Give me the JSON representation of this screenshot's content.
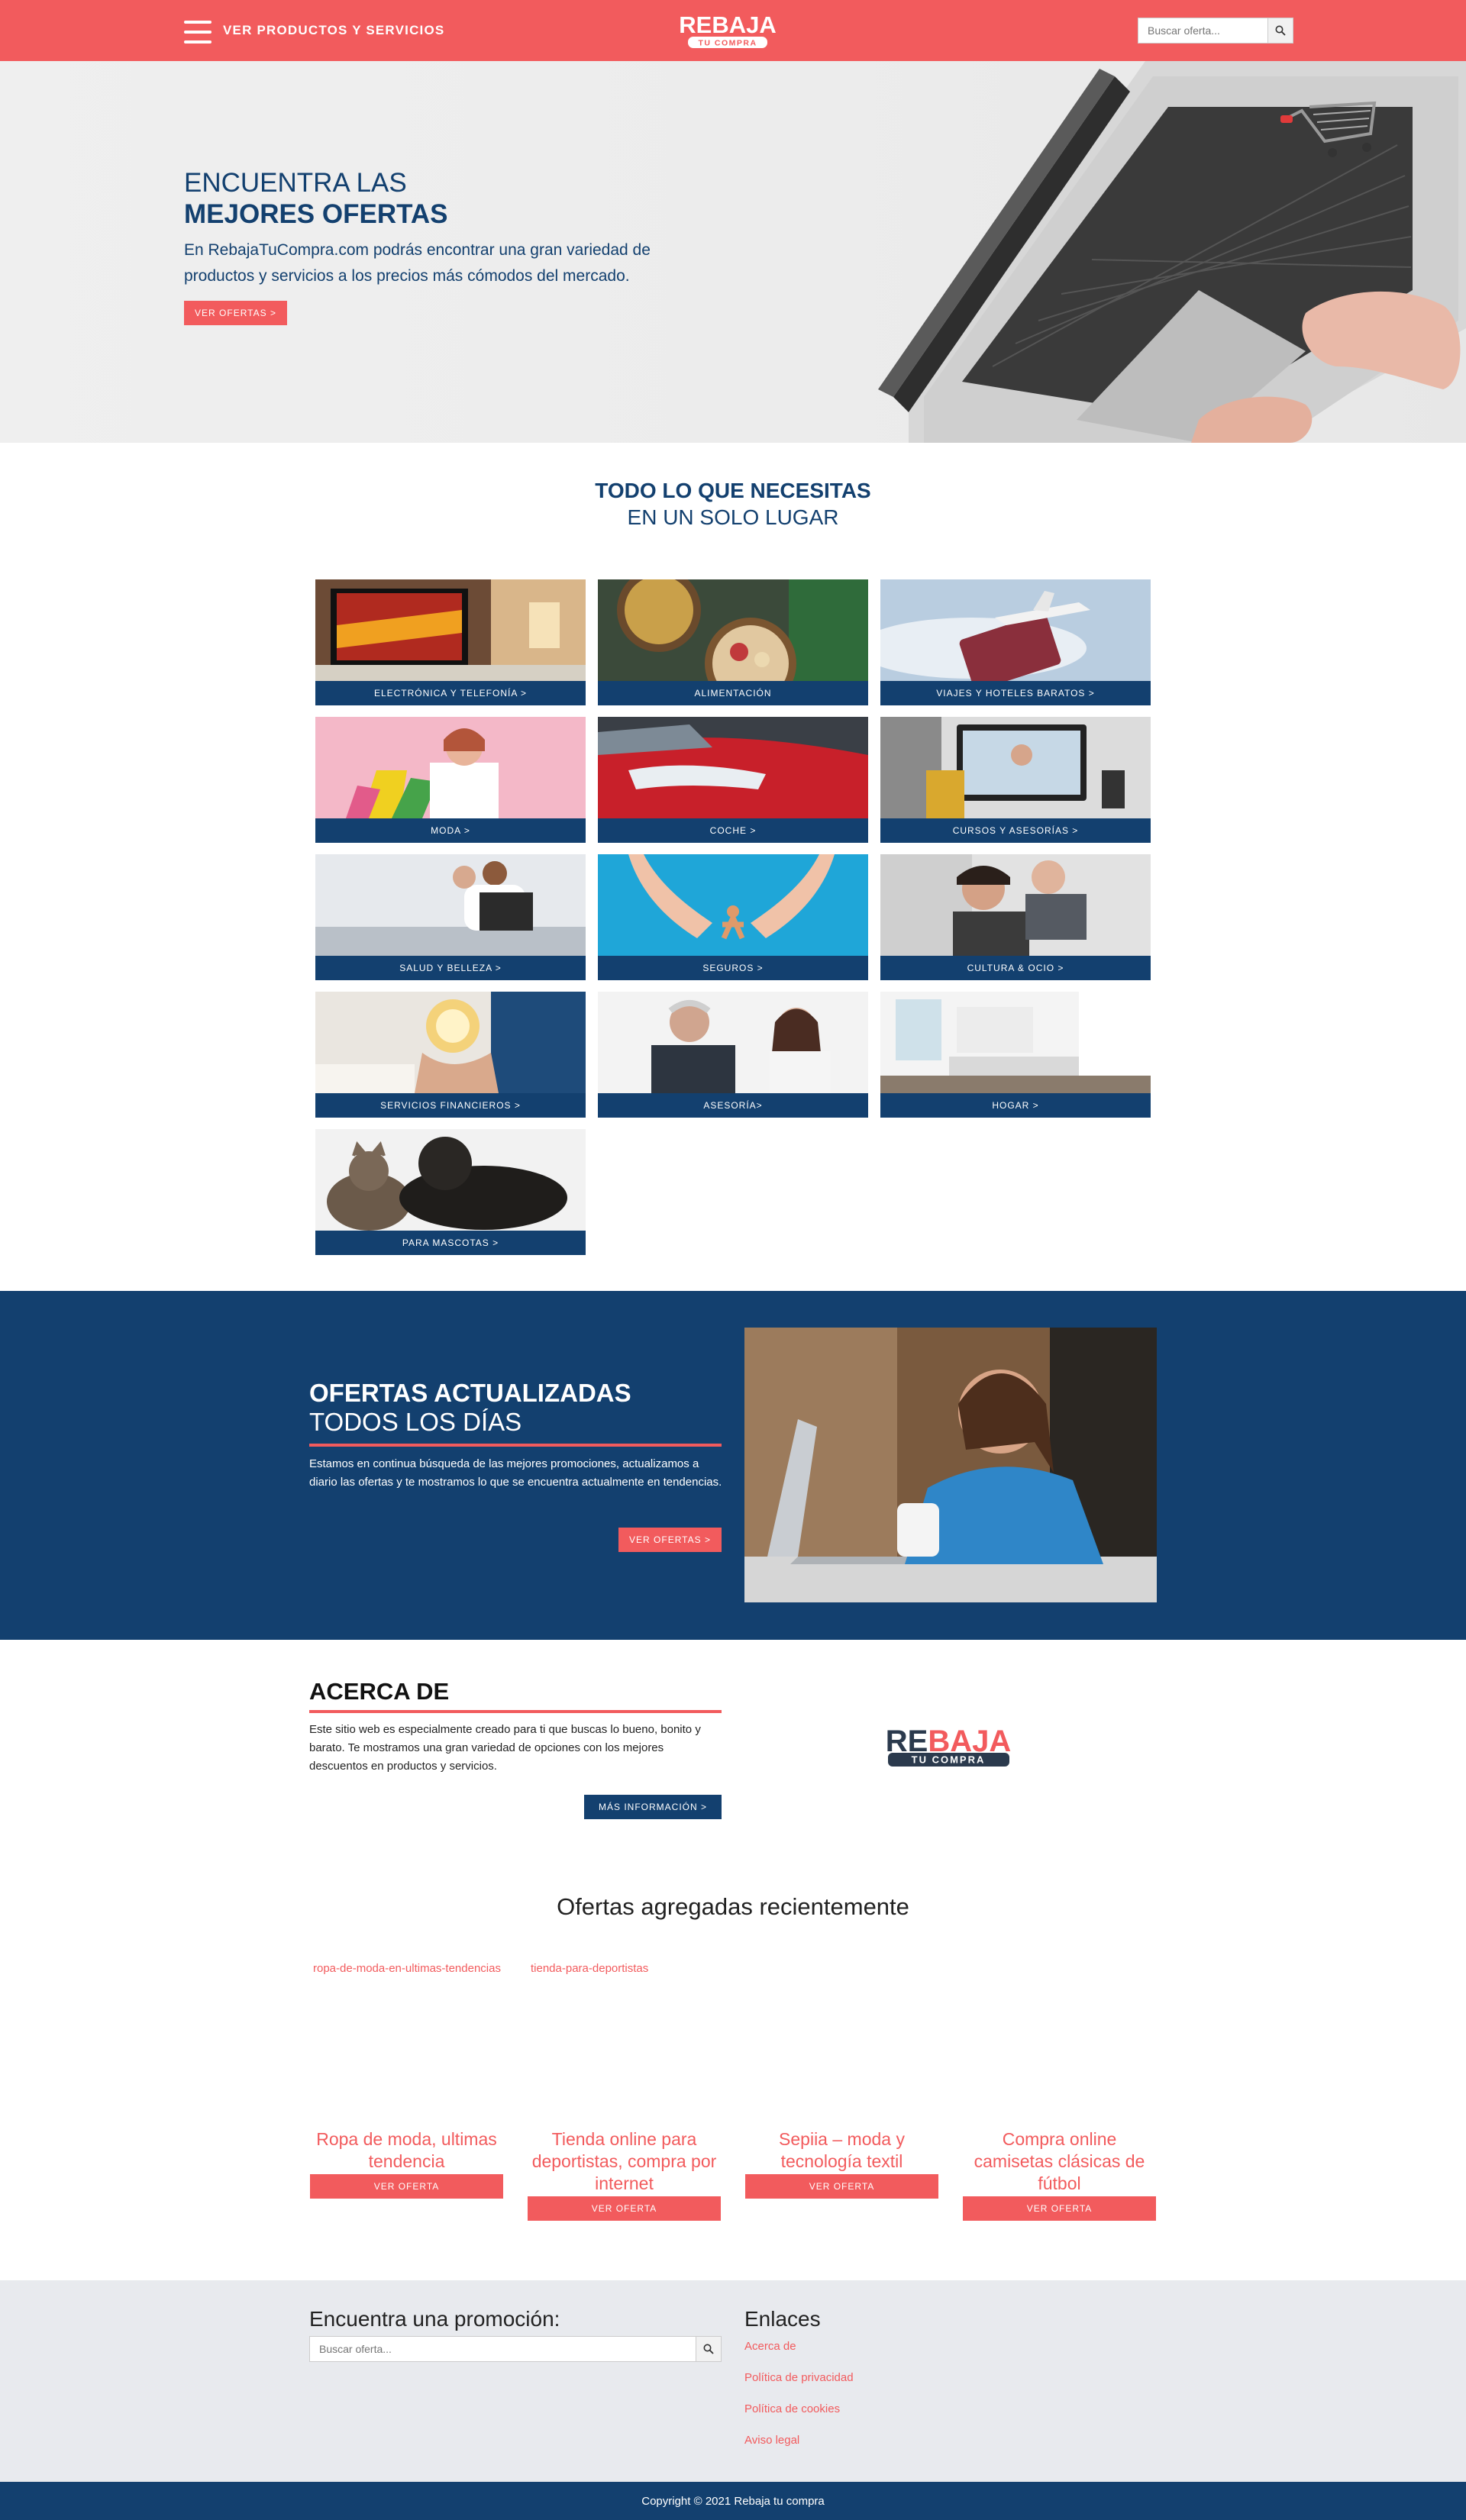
{
  "header": {
    "menu_label": "VER PRODUCTOS Y SERVICIOS",
    "logo_main": "REBAJA",
    "logo_sub": "TU COMPRA",
    "search_placeholder": "Buscar oferta..."
  },
  "hero": {
    "title_line1": "ENCUENTRA LAS",
    "title_line2": "MEJORES OFERTAS",
    "description": "En RebajaTuCompra.com podrás encontrar una gran variedad de productos y servicios a los precios más cómodos del mercado.",
    "button": "VER OFERTAS >"
  },
  "categories_section": {
    "title_line1": "TODO LO QUE NECESITAS",
    "title_line2": "EN UN SOLO LUGAR",
    "items": [
      "ELECTRÓNICA Y TELEFONÍA >",
      "ALIMENTACIÓN",
      "VIAJES Y HOTELES BARATOS >",
      "MODA >",
      "COCHE >",
      "CURSOS Y ASESORÍAS >",
      "SALUD Y BELLEZA >",
      "SEGUROS >",
      "CULTURA & OCIO >",
      "SERVICIOS FINANCIEROS >",
      "ASESORÍA>",
      "HOGAR >",
      "PARA MASCOTAS >"
    ]
  },
  "updated_offers": {
    "title_line1": "OFERTAS ACTUALIZADAS",
    "title_line2": "TODOS LOS DÍAS",
    "description": "Estamos en continua búsqueda de las mejores promociones, actualizamos a diario las ofertas y te mostramos lo que se encuentra actualmente en tendencias.",
    "button": "VER OFERTAS >"
  },
  "about": {
    "title": "ACERCA DE",
    "description": "Este sitio web es especialmente creado para ti que buscas lo bueno, bonito y barato. Te mostramos una gran variedad de opciones con los mejores descuentos en productos y servicios.",
    "button": "MÁS INFORMACIÓN >"
  },
  "recent": {
    "title": "Ofertas agregadas recientemente",
    "broken_images": [
      "ropa-de-moda-en-ultimas-tendencias",
      "tienda-para-deportistas"
    ],
    "offers": [
      "Ropa de moda, ultimas tendencia",
      "Tienda online para deportistas, compra por internet",
      "Sepiia – moda y tecnología textil",
      "Compra online camisetas clásicas de fútbol"
    ],
    "button": "VER OFERTA"
  },
  "footer": {
    "search_title": "Encuentra una promoción:",
    "search_placeholder": "Buscar oferta...",
    "links_title": "Enlaces",
    "links": [
      "Acerca de",
      "Política de privacidad",
      "Política de cookies",
      "Aviso legal"
    ],
    "copyright": "Copyright © 2021 Rebaja tu compra"
  },
  "colors": {
    "brand_red": "#f25b5d",
    "brand_blue": "#13406f",
    "footer_bg": "#e8eaee"
  }
}
